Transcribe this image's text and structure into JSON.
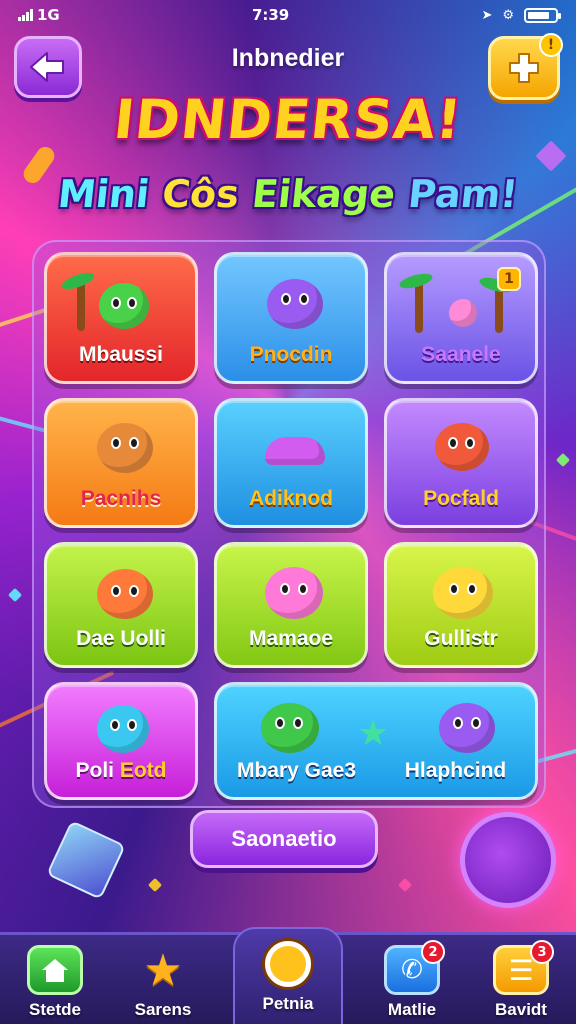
{
  "status_bar": {
    "signal_label": "1G",
    "time": "7:39",
    "battery_level": 0.8
  },
  "header": {
    "back_icon": "back-arrow-icon",
    "label": "Inbnedier",
    "add_icon": "add-puzzle-icon",
    "add_badge": "!"
  },
  "title": "IDNDERSA!",
  "subtitle": {
    "part1": "Mini",
    "part2": "Côs",
    "part3": "Eikage",
    "part4": "Pam!"
  },
  "games": [
    {
      "label": "Mbaussi",
      "colors": {
        "bg": "#f24a3a",
        "text": "#ffffff"
      },
      "badge": ""
    },
    {
      "label": "Pnocdin",
      "colors": {
        "bg": "#3fa9f5",
        "text": "#ffb21e"
      },
      "badge": ""
    },
    {
      "label": "Saanele",
      "colors": {
        "bg": "#8f6ef2",
        "text": "#c778ff"
      },
      "badge": "1"
    },
    {
      "label": "Pacnihs",
      "colors": {
        "bg": "#ff9a2a",
        "text": "#e2264a"
      },
      "badge": ""
    },
    {
      "label": "Adiknod",
      "colors": {
        "bg": "#31a9f0",
        "text": "#ffc21c"
      },
      "badge": ""
    },
    {
      "label": "Pocfald",
      "colors": {
        "bg": "#a45cf0",
        "text": "#ffd12a"
      },
      "badge": ""
    },
    {
      "label": "Dae Uolli",
      "colors": {
        "bg": "#9ede1f",
        "text": "#ffffff"
      },
      "badge": ""
    },
    {
      "label": "Mamaoe",
      "colors": {
        "bg": "#a2e024",
        "text": "#ffffff"
      },
      "badge": ""
    },
    {
      "label": "Gullistr",
      "colors": {
        "bg": "#b7e020",
        "text": "#ffffff"
      },
      "badge": ""
    },
    {
      "label_a": "Poli",
      "label_b": "Eotd",
      "colors": {
        "bg": "#e64af0",
        "text": "#ffffff"
      },
      "badge": ""
    },
    {
      "label": "Mbary Gae3",
      "colors": {
        "bg": "#28b8f0",
        "text": "#ffffff"
      },
      "badge": ""
    },
    {
      "label": "Hlaphcind",
      "colors": {
        "bg": "#28b8f0",
        "text": "#ffffff"
      },
      "badge": ""
    }
  ],
  "action_button": "Saonaetio",
  "nav": [
    {
      "label": "Stetde",
      "icon": "home-icon",
      "badge": ""
    },
    {
      "label": "Sarens",
      "icon": "star-icon",
      "badge": ""
    },
    {
      "label": "Petnia",
      "icon": "magnifier-icon",
      "badge": ""
    },
    {
      "label": "Matlie",
      "icon": "phone-icon",
      "badge": "2"
    },
    {
      "label": "Bavidt",
      "icon": "menu-icon",
      "badge": "3"
    }
  ]
}
